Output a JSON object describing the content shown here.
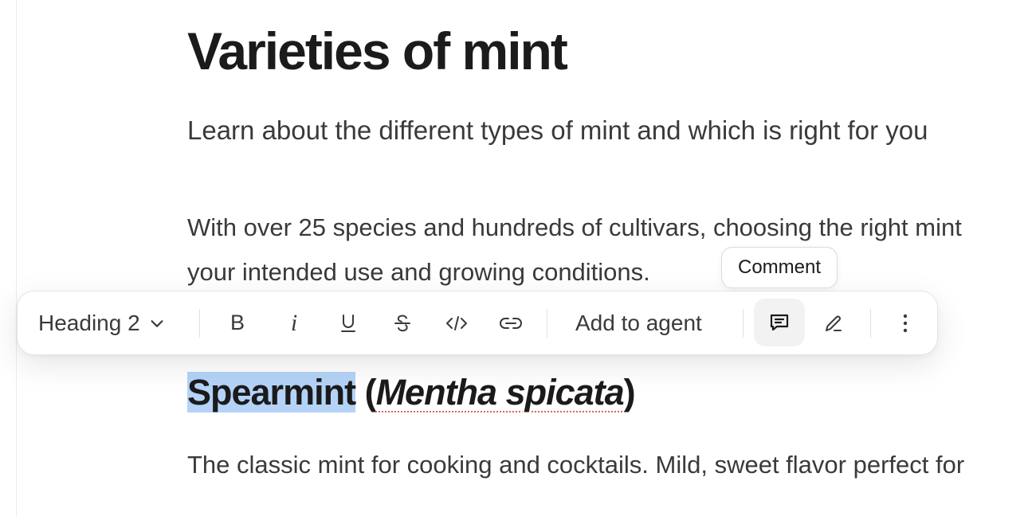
{
  "document": {
    "title": "Varieties of mint",
    "subtitle": "Learn about the different types of mint and which is right for you",
    "intro_line1": "With over 25 species and hundreds of cultivars, choosing the right mint",
    "intro_line2": "your intended use and growing conditions.",
    "heading2_selected": "Spearmint",
    "heading2_open": " (",
    "heading2_latin": "Mentha spicata",
    "heading2_close": ")",
    "body": "The classic mint for cooking and cocktails. Mild, sweet flavor perfect for"
  },
  "toolbar": {
    "block_style": "Heading 2",
    "add_to_agent": "Add to agent",
    "buttons": {
      "bold": "B",
      "italic": "i"
    },
    "tooltip": "Comment"
  },
  "colors": {
    "selection": "#b4d3f7",
    "spellcheck_underline": "#e06060",
    "active_button_bg": "#f2f2f2"
  },
  "icons": [
    "chevron-down-icon",
    "underline-icon",
    "strikethrough-icon",
    "code-icon",
    "link-icon",
    "comment-icon",
    "pen-icon",
    "more-vertical-icon"
  ]
}
